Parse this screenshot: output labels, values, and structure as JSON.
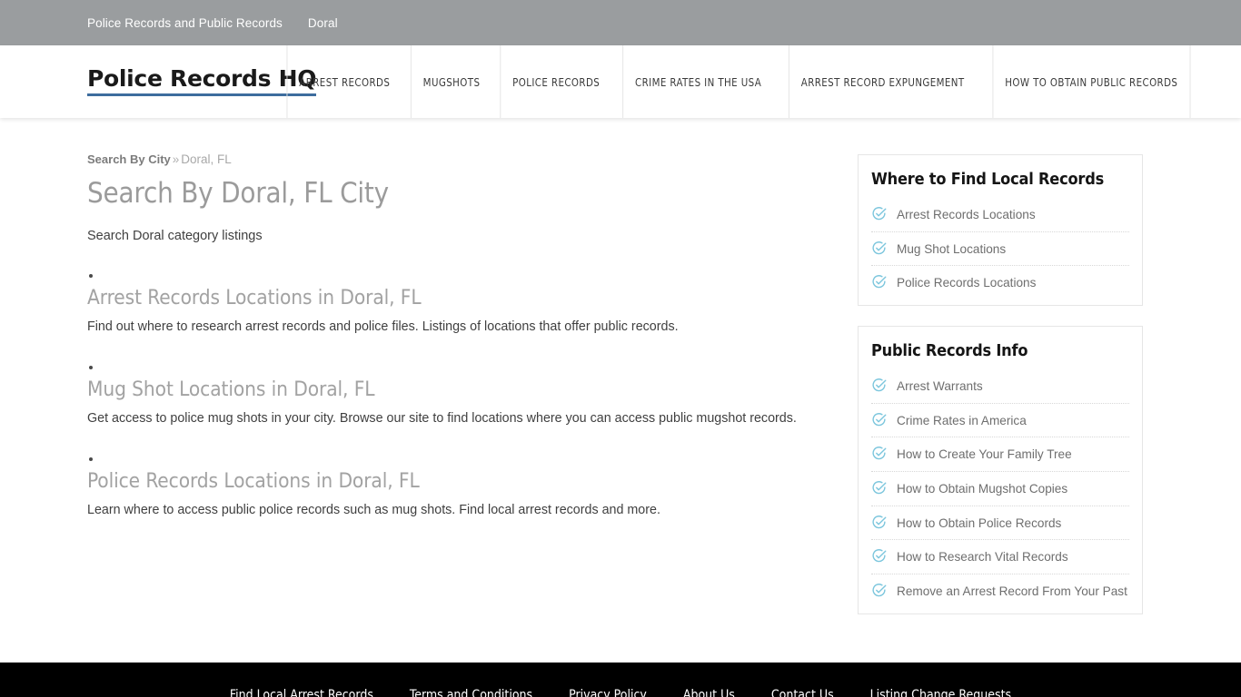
{
  "topbar": {
    "links": [
      {
        "label": "Police Records and Public Records"
      },
      {
        "label": "Doral"
      }
    ]
  },
  "header": {
    "logo": "Police Records HQ",
    "logo_underline_color": "#3d6d9e",
    "nav": [
      {
        "label": "ARREST RECORDS"
      },
      {
        "label": "MUGSHOTS"
      },
      {
        "label": "POLICE RECORDS"
      },
      {
        "label": "CRIME RATES IN THE USA"
      },
      {
        "label": "ARREST RECORD EXPUNGEMENT"
      },
      {
        "label": "HOW TO OBTAIN PUBLIC RECORDS"
      }
    ]
  },
  "main": {
    "breadcrumb": {
      "parent": "Search By City",
      "separator": "»",
      "current": "Doral, FL"
    },
    "title": "Search By Doral, FL City",
    "intro": "Search Doral category listings",
    "sections": [
      {
        "title": "Arrest Records Locations in Doral, FL",
        "description": "Find out where to research arrest records and police files. Listings of locations that offer public records."
      },
      {
        "title": "Mug Shot Locations in Doral, FL",
        "description": "Get access to police mug shots in your city. Browse our site to find locations where you can access public mugshot records."
      },
      {
        "title": "Police Records Locations in Doral, FL",
        "description": "Learn where to access public police records such as mug shots. Find local arrest records and more."
      }
    ]
  },
  "sidebar": {
    "icon_color": "#7cc6dd",
    "widgets": [
      {
        "title": "Where to Find Local Records",
        "items": [
          {
            "label": "Arrest Records Locations",
            "icon": "check-circle-icon"
          },
          {
            "label": "Mug Shot Locations",
            "icon": "check-circle-icon"
          },
          {
            "label": "Police Records Locations",
            "icon": "check-circle-icon"
          }
        ]
      },
      {
        "title": "Public Records Info",
        "items": [
          {
            "label": "Arrest Warrants",
            "icon": "check-circle-icon"
          },
          {
            "label": "Crime Rates in America",
            "icon": "check-circle-icon"
          },
          {
            "label": "How to Create Your Family Tree",
            "icon": "check-circle-icon"
          },
          {
            "label": "How to Obtain Mugshot Copies",
            "icon": "check-circle-icon"
          },
          {
            "label": "How to Obtain Police Records",
            "icon": "check-circle-icon"
          },
          {
            "label": "How to Research Vital Records",
            "icon": "check-circle-icon"
          },
          {
            "label": "Remove an Arrest Record From Your Past",
            "icon": "check-circle-icon"
          }
        ]
      }
    ]
  },
  "footer": {
    "links": [
      {
        "label": "Find Local Arrest Records"
      },
      {
        "label": "Terms and Conditions"
      },
      {
        "label": "Privacy Policy"
      },
      {
        "label": "About Us"
      },
      {
        "label": "Contact Us"
      },
      {
        "label": "Listing Change Requests"
      }
    ]
  }
}
